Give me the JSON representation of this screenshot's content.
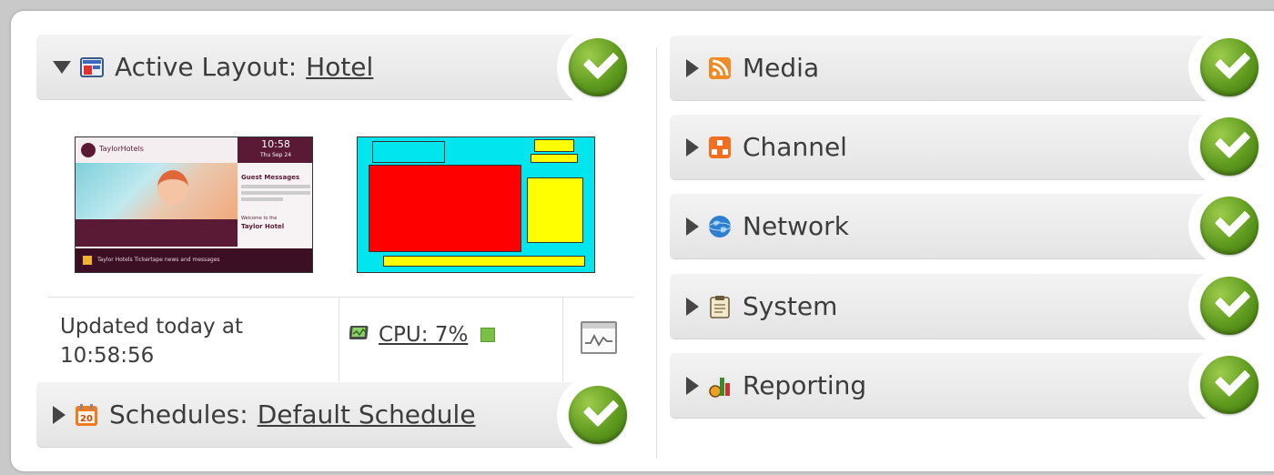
{
  "left": {
    "active_layout": {
      "label": "Active Layout:",
      "link": "Hotel"
    },
    "thumb_hotel": {
      "brand": "TaylorHotels",
      "clock": "10:58",
      "clock_sub": "Thu Sep 24",
      "guest_messages": "Guest Messages",
      "welcome_line1": "Welcome to the",
      "hotel_name": "Taylor Hotel",
      "ticker": "Taylor Hotels Tickertape news and messages"
    },
    "status": {
      "updated_line1": "Updated today at",
      "updated_line2": "10:58:56",
      "cpu_label": "CPU: 7%"
    },
    "schedules": {
      "label": "Schedules:",
      "link": "Default Schedule"
    }
  },
  "right": {
    "sections": [
      {
        "label": "Media",
        "icon": "rss-icon"
      },
      {
        "label": "Channel",
        "icon": "channel-icon"
      },
      {
        "label": "Network",
        "icon": "globe-icon"
      },
      {
        "label": "System",
        "icon": "clipboard-icon"
      },
      {
        "label": "Reporting",
        "icon": "reporting-icon"
      }
    ]
  },
  "colors": {
    "check_green": "#5e9a1e",
    "cpu_indicator": "#7bc044",
    "layout_zone_cyan": "#00e5ee",
    "layout_zone_red": "#ff0000",
    "layout_zone_yellow": "#ffff00",
    "hotel_maroon": "#5a1a36"
  }
}
